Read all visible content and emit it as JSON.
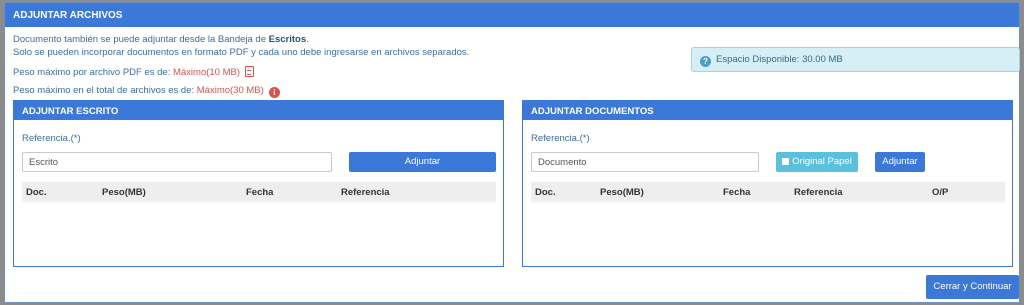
{
  "header": {
    "title": "ADJUNTAR ARCHIVOS"
  },
  "info": {
    "line1_prefix": "Documento también se puede adjuntar desde la Bandeja de ",
    "line1_bold": "Escritos",
    "line1_suffix": ".",
    "line2": "Solo se pueden incorporar documentos en formato PDF y cada uno debe ingresarse en archivos separados.",
    "line3_prefix": "Peso máximo por archivo PDF es de: ",
    "line3_value": "Máximo(10 MB)",
    "line4_prefix": "Peso máximo en el total de archivos es de: ",
    "line4_value": "Máximo(30 MB)"
  },
  "space": {
    "label": "Espacio Disponible: 30.00 MB"
  },
  "escrito": {
    "title": "ADJUNTAR ESCRITO",
    "ref_label": "Referencia.(*)",
    "input_placeholder": "Escrito",
    "adjuntar_label": "Adjuntar",
    "columns": [
      "Doc.",
      "Peso(MB)",
      "Fecha",
      "Referencia"
    ],
    "rows": []
  },
  "documentos": {
    "title": "ADJUNTAR DOCUMENTOS",
    "ref_label": "Referencia.(*)",
    "input_placeholder": "Documento",
    "original_label": "Original Papel",
    "adjuntar_label": "Adjuntar",
    "columns": [
      "Doc.",
      "Peso(MB)",
      "Fecha",
      "Referencia",
      "O/P"
    ],
    "rows": []
  },
  "footer": {
    "continue_label": "Cerrar y Continuar"
  },
  "colors": {
    "primary": "#3b78d8",
    "info": "#5bc0de",
    "danger": "#d9534f"
  }
}
